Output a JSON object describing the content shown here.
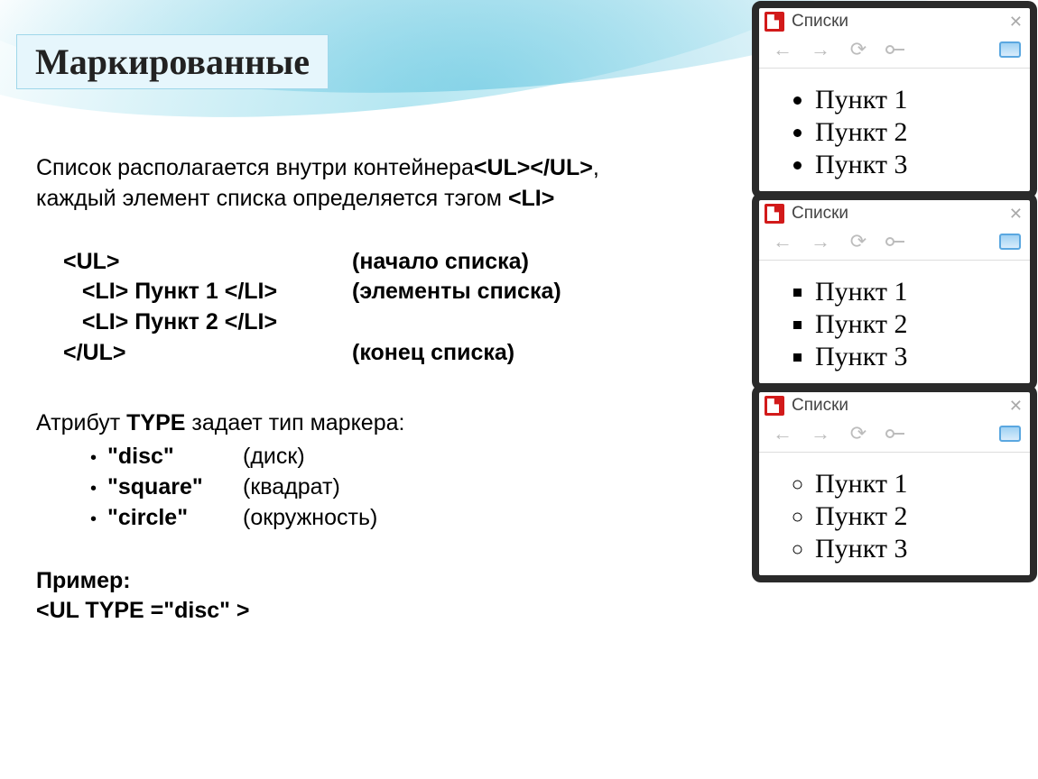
{
  "title": "Маркированные",
  "intro": {
    "line1_pre": "Список располагается внутри контейнера",
    "tag_ul_open": "<UL>",
    "tag_ul_close": "</UL>",
    "comma": ",",
    "line2_pre": "каждый элемент списка определяется тэгом ",
    "tag_li": "<LI>"
  },
  "code": {
    "rows": [
      {
        "c1": "<UL>",
        "c2": "(начало списка)"
      },
      {
        "c1": "   <LI> Пункт 1 </LI>",
        "c2": "(элементы списка)"
      },
      {
        "c1": "   <LI> Пункт 2 </LI>",
        "c2": ""
      },
      {
        "c1": "</UL>",
        "c2": "(конец списка)"
      }
    ]
  },
  "attr": {
    "pre": "Атрибут ",
    "name": "TYPE",
    "post": " задает тип маркера:",
    "items": [
      {
        "v": "\"disc\"",
        "d": "(диск)"
      },
      {
        "v": "\"square\"",
        "d": "(квадрат)"
      },
      {
        "v": "\"circle\"",
        "d": "(окружность)"
      }
    ]
  },
  "example": {
    "label": "Пример:",
    "code": "<UL TYPE =\"disc\" >"
  },
  "panels": [
    {
      "title": "Списки",
      "type": "disc",
      "items": [
        "Пункт 1",
        "Пункт 2",
        "Пункт 3"
      ]
    },
    {
      "title": "Списки",
      "type": "square",
      "items": [
        "Пункт 1",
        "Пункт 2",
        "Пункт 3"
      ]
    },
    {
      "title": "Списки",
      "type": "circle",
      "items": [
        "Пункт 1",
        "Пункт 2",
        "Пункт 3"
      ]
    }
  ]
}
